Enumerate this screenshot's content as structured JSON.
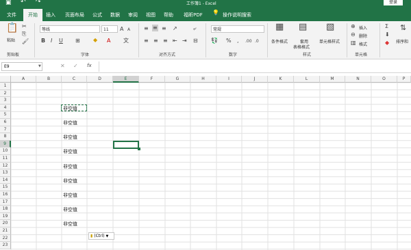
{
  "title_bar": {
    "title": "工作簿1 - Excel",
    "login": "登录"
  },
  "tabs": [
    "文件",
    "开始",
    "插入",
    "页面布局",
    "公式",
    "数据",
    "审阅",
    "视图",
    "帮助",
    "福昕PDF"
  ],
  "tell_me": "操作说明搜索",
  "ribbon": {
    "paste": "粘贴",
    "clipboard": "剪贴板",
    "font_name": "等线",
    "font_size": "11",
    "font_group": "字体",
    "alignment_group": "对齐方式",
    "number_format": "常规",
    "number_group": "数字",
    "conditional_format": "条件格式",
    "table_format_1": "套用",
    "table_format_2": "表格格式",
    "cell_styles": "单元格样式",
    "styles_group": "样式",
    "insert": "插入",
    "delete": "删除",
    "format": "格式",
    "cells_group": "单元格",
    "sort_filter": "排序和"
  },
  "formula_bar": {
    "name_box": "E9",
    "fx": "fx",
    "value": ""
  },
  "columns": [
    "A",
    "B",
    "C",
    "D",
    "E",
    "F",
    "G",
    "H",
    "I",
    "J",
    "K",
    "L",
    "M",
    "N",
    "O",
    "P"
  ],
  "rows": [
    "1",
    "2",
    "3",
    "4",
    "5",
    "6",
    "7",
    "8",
    "9",
    "10",
    "11",
    "12",
    "13",
    "14",
    "15",
    "16",
    "17",
    "18",
    "19",
    "20",
    "21",
    "22",
    "23"
  ],
  "cells": [
    {
      "ref": "C4",
      "text": "非空值"
    },
    {
      "ref": "C6",
      "text": "非空值"
    },
    {
      "ref": "C8",
      "text": "非空值"
    },
    {
      "ref": "C10",
      "text": "非空值"
    },
    {
      "ref": "C12",
      "text": "非空值"
    },
    {
      "ref": "C14",
      "text": "非空值"
    },
    {
      "ref": "C16",
      "text": "非空值"
    },
    {
      "ref": "C18",
      "text": "非空值"
    },
    {
      "ref": "C20",
      "text": "非空值"
    }
  ],
  "paste_options": "(Ctrl)",
  "colors": {
    "excel_green": "#217346",
    "selection": "#217346"
  }
}
